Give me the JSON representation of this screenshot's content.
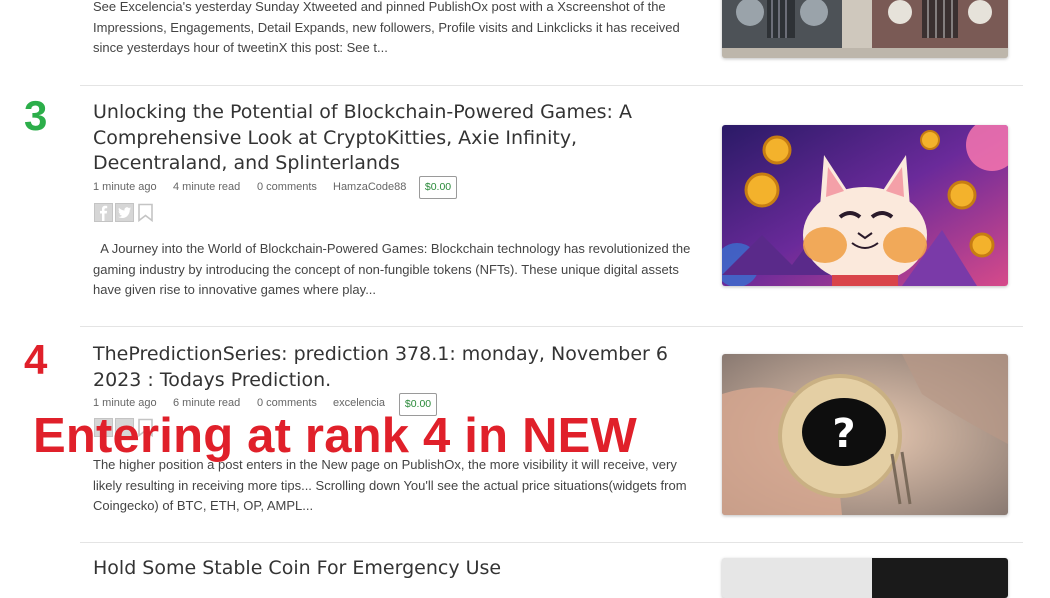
{
  "posts": [
    {
      "excerpt": "See Excelencia's yesterday Sunday Xtweeted and pinned PublishOx post  with a Xscreenshot of the Impressions, Engagements, Detail Expands, new followers, Profile visits and Linkclicks it has received since yesterdays hour of tweetinX this post: See t...",
      "image_icon": "vintage-cars-image"
    },
    {
      "rank": "3",
      "title": "Unlocking the Potential of Blockchain-Powered Games: A Comprehensive Look at CryptoKitties, Axie Infinity, Decentraland, and Splinterlands",
      "time_ago": "1 minute ago",
      "read_time": "4 minute read",
      "comments": "0 comments",
      "author": "HamzaCode88",
      "tips": "$0.00",
      "excerpt": "  A Journey into the World of Blockchain-Powered Games: Blockchain technology has revolutionized the gaming industry by introducing the concept of non-fungible tokens (NFTs). These unique digital assets have given rise to innovative games where play...",
      "image_icon": "cartoon-cat-coins-image"
    },
    {
      "rank": "4",
      "title": "ThePredictionSeries: prediction 378.1: monday, November 6 2023 : Todays Prediction.",
      "time_ago": "1 minute ago",
      "read_time": "6 minute read",
      "comments": "0 comments",
      "author": "excelencia",
      "tips": "$0.00",
      "excerpt": "The higher position a post enters in the New page on PublishOx, the more visibility it will receive, very likely resulting in receiving more tips... Scrolling down You'll see the actual price situations(widgets from Coingecko) of BTC, ETH, OP,  AMPL...",
      "image_icon": "question-coin-hand-image"
    },
    {
      "title": "Hold Some Stable Coin For Emergency Use",
      "image_icon": "dark-image"
    }
  ],
  "overlay_text": "Entering at rank 4 in NEW",
  "colors": {
    "rank3": "#2cae4a",
    "rank4": "#e0202a",
    "overlay": "#e0202a",
    "tips": "#2a8a3a"
  }
}
